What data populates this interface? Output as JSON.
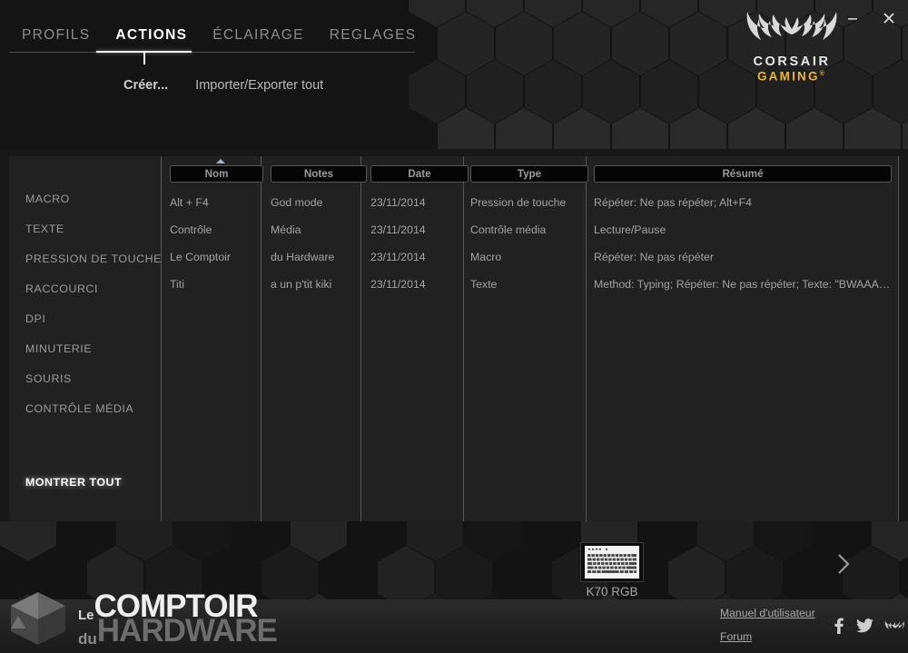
{
  "window": {
    "minimize_label": "Minimize",
    "close_label": "Close"
  },
  "brand": {
    "line1": "CORSAIR",
    "line2": "GAMING",
    "trademark": "®"
  },
  "tabs": [
    {
      "label": "PROFILS",
      "active": false
    },
    {
      "label": "ACTIONS",
      "active": true
    },
    {
      "label": "ÉCLAIRAGE",
      "active": false
    },
    {
      "label": "REGLAGES",
      "active": false
    }
  ],
  "subnav": [
    {
      "label": "Créer...",
      "bold": true
    },
    {
      "label": "Importer/Exporter tout",
      "bold": false
    }
  ],
  "sidebar": {
    "items": [
      {
        "label": "MACRO",
        "selected": false
      },
      {
        "label": "TEXTE",
        "selected": false
      },
      {
        "label": "PRESSION DE TOUCHE",
        "selected": false
      },
      {
        "label": "RACCOURCI",
        "selected": false
      },
      {
        "label": "DPI",
        "selected": false
      },
      {
        "label": "MINUTERIE",
        "selected": false
      },
      {
        "label": "SOURIS",
        "selected": false
      },
      {
        "label": "CONTRÔLE MÉDIA",
        "selected": false
      }
    ],
    "show_all": {
      "label": "MONTRER TOUT",
      "selected": true
    }
  },
  "table": {
    "columns": [
      {
        "label": "Nom",
        "sorted": true,
        "sort_direction": "asc"
      },
      {
        "label": "Notes",
        "sorted": false
      },
      {
        "label": "Date",
        "sorted": false
      },
      {
        "label": "Type",
        "sorted": false
      },
      {
        "label": "Résumé",
        "sorted": false
      }
    ],
    "rows": [
      {
        "nom": "Alt + F4",
        "notes": "God mode",
        "date": "23/11/2014",
        "type": "Pression de touche",
        "resume": "Répéter: Ne pas répéter; Alt+F4"
      },
      {
        "nom": "Contrôle",
        "notes": "Média",
        "date": "23/11/2014",
        "type": "Contrôle média",
        "resume": "Lecture/Pause"
      },
      {
        "nom": "Le Comptoir",
        "notes": "du Hardware",
        "date": "23/11/2014",
        "type": "Macro",
        "resume": "Répéter: Ne pas répéter"
      },
      {
        "nom": "Titi",
        "notes": "a un p'tit kiki",
        "date": "23/11/2014",
        "type": "Texte",
        "resume": "Method: Typing; Répéter: Ne pas répéter; Texte: \"BWAAA…"
      }
    ]
  },
  "device": {
    "name": "K70 RGB",
    "next_label": "Next device"
  },
  "watermark": {
    "line1_small": "Le",
    "line1_big": "COMPTOIR",
    "line2_small": "du",
    "line2_big": "HARDWARE"
  },
  "footer": {
    "links": [
      {
        "label": "Manuel d'utilisateur"
      },
      {
        "label": "Forum"
      }
    ],
    "social": [
      {
        "name": "facebook-icon"
      },
      {
        "name": "twitter-icon"
      },
      {
        "name": "corsair-sails-icon"
      }
    ]
  },
  "colors": {
    "accent_yellow": "#f0b428",
    "panel_bg": "#212121",
    "header_bg": "#141414",
    "text_muted": "#9a9a9a",
    "text_bright": "#ffffff",
    "sort_arrow": "#9fb4c6"
  }
}
